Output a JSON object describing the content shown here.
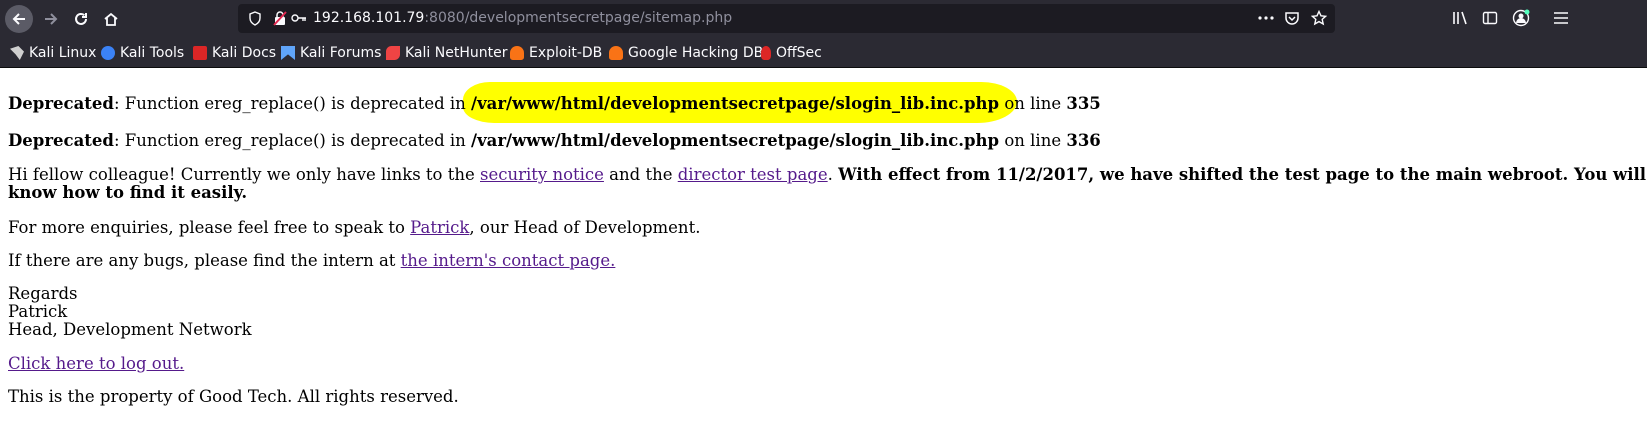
{
  "browser": {
    "url_host": "192.168.101.79",
    "url_rest": ":8080/developmentsecretpage/sitemap.php",
    "bookmarks": [
      {
        "label": "Kali Linux",
        "icon": "kali-dragon-icon",
        "color": "#cfcfcf"
      },
      {
        "label": "Kali Tools",
        "icon": "kali-tools-icon",
        "color": "#3b82f6"
      },
      {
        "label": "Kali Docs",
        "icon": "kali-docs-icon",
        "color": "#dc2626"
      },
      {
        "label": "Kali Forums",
        "icon": "kali-forums-icon",
        "color": "#60a5fa"
      },
      {
        "label": "Kali NetHunter",
        "icon": "nethunter-icon",
        "color": "#ef4444"
      },
      {
        "label": "Exploit-DB",
        "icon": "exploit-db-icon",
        "color": "#f97316"
      },
      {
        "label": "Google Hacking DB",
        "icon": "ghdb-icon",
        "color": "#f97316"
      },
      {
        "label": "OffSec",
        "icon": "offsec-icon",
        "color": "#dc2626"
      }
    ]
  },
  "page": {
    "dep1": {
      "label": "Deprecated",
      "text": ": Function ereg_replace() is deprecated in ",
      "path": "/var/www/html/developmentsecretpage/slogin_lib.inc.php",
      "online": " on line ",
      "line": "335"
    },
    "dep2": {
      "label": "Deprecated",
      "text": ": Function ereg_replace() is deprecated in ",
      "path": "/var/www/html/developmentsecretpage/slogin_lib.inc.php",
      "online": " on line ",
      "line": "336"
    },
    "intro": {
      "t1": "Hi fellow colleague! Currently we only have links to the ",
      "link1": "security notice",
      "t2": " and the ",
      "link2": "director test page",
      "t3": ". ",
      "bold": "With effect from 11/2/2017, we have shifted the test page to the main webroot. You will know how to find it easily."
    },
    "enquiries": {
      "t1": "For more enquiries, please feel free to speak to ",
      "link": "Patrick",
      "t2": ", our Head of Development."
    },
    "bugs": {
      "t1": "If there are any bugs, please find the intern at ",
      "link": "the intern's contact page."
    },
    "regards": [
      "Regards",
      "Patrick",
      "Head, Development Network"
    ],
    "logout": "Click here to log out.",
    "footer": "This is the property of Good Tech. All rights reserved."
  }
}
